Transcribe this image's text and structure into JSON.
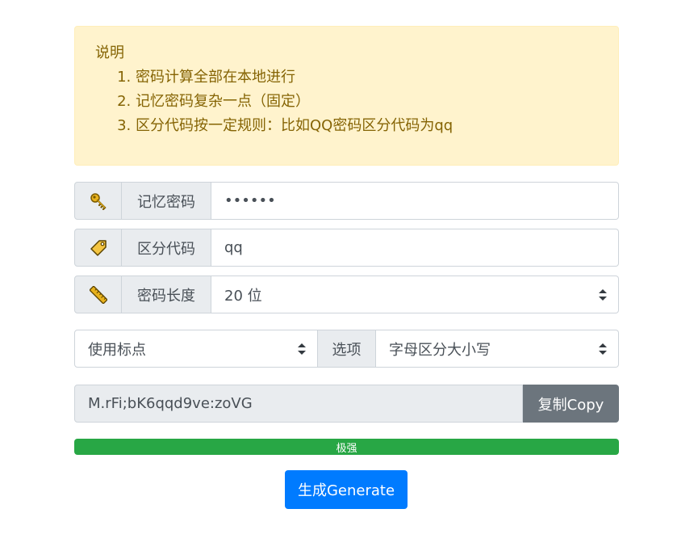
{
  "notice": {
    "heading": "说明",
    "items": [
      "密码计算全部在本地进行",
      "记忆密码复杂一点（固定）",
      "区分代码按一定规则：比如QQ密码区分代码为qq"
    ]
  },
  "memory_password": {
    "label": "记忆密码",
    "value": "••••••",
    "icon": "key-icon"
  },
  "distinguish_code": {
    "label": "区分代码",
    "value": "qq",
    "icon": "tag-icon"
  },
  "password_length": {
    "label": "密码长度",
    "selected": "20 位",
    "icon": "ruler-icon"
  },
  "punctuation": {
    "selected": "使用标点"
  },
  "options": {
    "label": "选项",
    "selected": "字母区分大小写"
  },
  "result": {
    "value": "M.rFi;bK6qqd9ve:zoVG",
    "copy_label": "复制Copy"
  },
  "strength": {
    "label": "极强",
    "level_percent": 100,
    "color": "#28a745"
  },
  "generate_label": "生成Generate",
  "colors": {
    "primary": "#007bff",
    "secondary": "#6c757d",
    "warning_bg": "#fff3cd",
    "success": "#28a745"
  }
}
